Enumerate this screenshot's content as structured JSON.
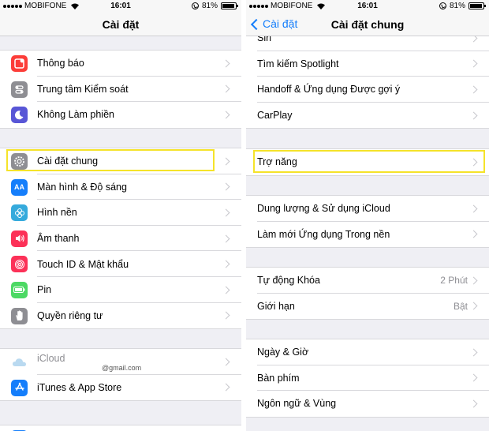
{
  "status": {
    "carrier": "MOBIFONE",
    "time": "16:01",
    "battery": "81%",
    "battery_level": 0.81
  },
  "left": {
    "title": "Cài đặt",
    "group1": [
      {
        "label": "Thông báo",
        "icon": "notifications-icon",
        "color": "#fc3d39"
      },
      {
        "label": "Trung tâm Kiểm soát",
        "icon": "control-center-icon",
        "color": "#8e8e93"
      },
      {
        "label": "Không Làm phiền",
        "icon": "moon-icon",
        "color": "#5856d6"
      }
    ],
    "group2": [
      {
        "label": "Cài đặt chung",
        "icon": "gear-icon",
        "color": "#8e8e93"
      },
      {
        "label": "Màn hình & Độ sáng",
        "icon": "display-brightness-icon",
        "color": "#157efb"
      },
      {
        "label": "Hình nền",
        "icon": "wallpaper-icon",
        "color": "#35aadc"
      },
      {
        "label": "Âm thanh",
        "icon": "sound-icon",
        "color": "#fc3158"
      },
      {
        "label": "Touch ID & Mật khẩu",
        "icon": "fingerprint-icon",
        "color": "#fc3158"
      },
      {
        "label": "Pin",
        "icon": "battery-icon",
        "color": "#4cd964"
      },
      {
        "label": "Quyền riêng tư",
        "icon": "hand-icon",
        "color": "#8e8e93"
      }
    ],
    "group3": {
      "icloud_label": "iCloud",
      "icloud_sub": "@gmail.com",
      "itunes_label": "iTunes & App Store"
    }
  },
  "right": {
    "title": "Cài đặt chung",
    "back": "Cài đặt",
    "group0": [
      {
        "label": "Siri"
      },
      {
        "label": "Tìm kiếm Spotlight"
      },
      {
        "label": "Handoff & Ứng dụng Được gợi ý"
      },
      {
        "label": "CarPlay"
      }
    ],
    "group1": [
      {
        "label": "Trợ năng"
      }
    ],
    "group2": [
      {
        "label": "Dung lượng & Sử dụng iCloud"
      },
      {
        "label": "Làm mới Ứng dụng Trong nền"
      }
    ],
    "group3": [
      {
        "label": "Tự động Khóa",
        "value": "2 Phút"
      },
      {
        "label": "Giới hạn",
        "value": "Bật"
      }
    ],
    "group4": [
      {
        "label": "Ngày & Giờ"
      },
      {
        "label": "Bàn phím"
      },
      {
        "label": "Ngôn ngữ & Vùng"
      }
    ]
  },
  "colors": {
    "accent": "#157efb",
    "highlight": "#f5e32a",
    "background": "#efeff4"
  }
}
